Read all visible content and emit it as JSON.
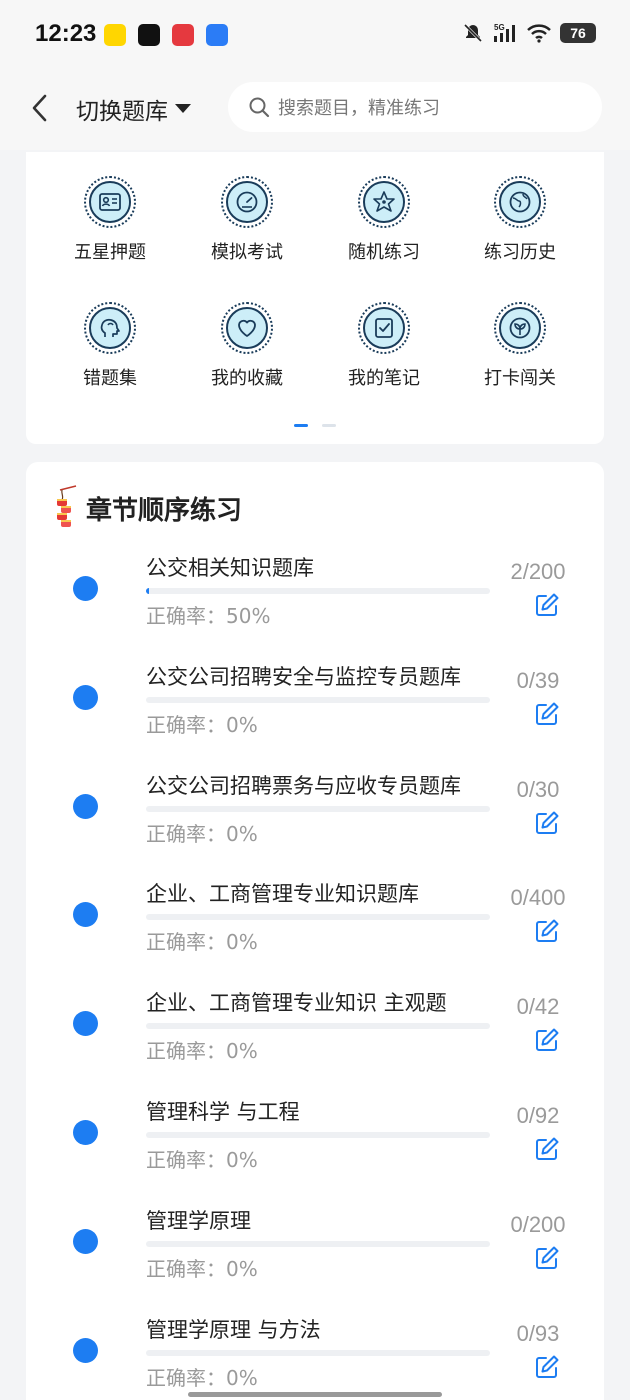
{
  "status_bar": {
    "time": "12:23",
    "battery": "76",
    "network": "5G",
    "icons": [
      "meituan-app-icon",
      "tiktok-app-icon",
      "game-app-icon",
      "security-app-icon",
      "mute-icon",
      "signal-icon",
      "wifi-icon",
      "battery-icon"
    ]
  },
  "header": {
    "back_icon": "chevron-left-icon",
    "switch_label": "切换题库",
    "search_placeholder": "搜索题目，精准练习"
  },
  "grid": {
    "items": [
      {
        "label": "五星押题",
        "icon": "id-card-icon"
      },
      {
        "label": "模拟考试",
        "icon": "gauge-icon"
      },
      {
        "label": "随机练习",
        "icon": "star-network-icon"
      },
      {
        "label": "练习历史",
        "icon": "globe-icon"
      },
      {
        "label": "错题集",
        "icon": "head-icon"
      },
      {
        "label": "我的收藏",
        "icon": "heart-icon"
      },
      {
        "label": "我的笔记",
        "icon": "note-check-icon"
      },
      {
        "label": "打卡闯关",
        "icon": "sprout-icon"
      }
    ],
    "page_count": 2,
    "active_page": 1
  },
  "chapter": {
    "title": "章节顺序练习",
    "rows": [
      {
        "title": "公交相关知识题库",
        "accuracy": "正确率：50%",
        "count": "2/200",
        "progress": 0.01
      },
      {
        "title": "公交公司招聘安全与监控专员题库",
        "accuracy": "正确率：0%",
        "count": "0/39",
        "progress": 0
      },
      {
        "title": "公交公司招聘票务与应收专员题库",
        "accuracy": "正确率：0%",
        "count": "0/30",
        "progress": 0
      },
      {
        "title": "企业、工商管理专业知识题库",
        "accuracy": "正确率：0%",
        "count": "0/400",
        "progress": 0
      },
      {
        "title": "企业、工商管理专业知识 主观题",
        "accuracy": "正确率：0%",
        "count": "0/42",
        "progress": 0
      },
      {
        "title": "管理科学 与工程",
        "accuracy": "正确率：0%",
        "count": "0/92",
        "progress": 0
      },
      {
        "title": "管理学原理",
        "accuracy": "正确率：0%",
        "count": "0/200",
        "progress": 0
      },
      {
        "title": "管理学原理 与方法",
        "accuracy": "正确率：0%",
        "count": "0/93",
        "progress": 0
      }
    ]
  },
  "colors": {
    "accent": "#1d7df2",
    "icon_fill": "#cdeef8",
    "icon_stroke": "#1a3c5a",
    "muted_text": "#9a9a9a"
  }
}
